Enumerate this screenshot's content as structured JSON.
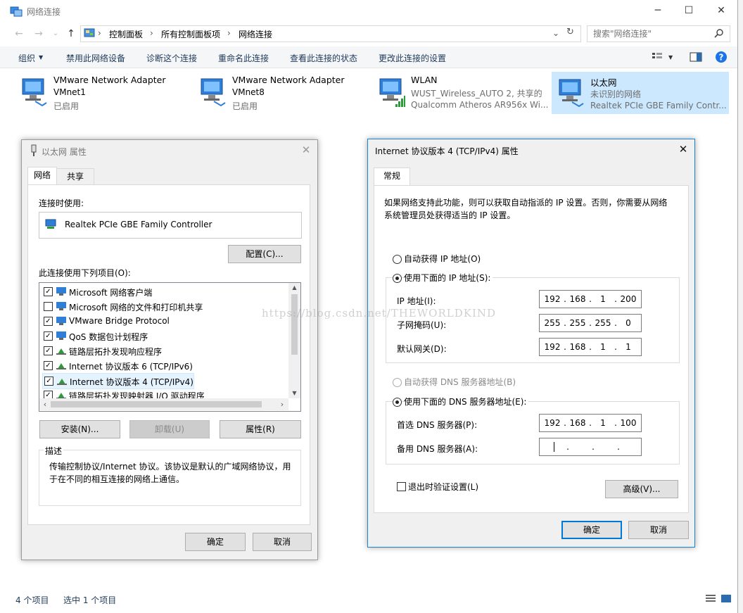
{
  "window": {
    "title": "网络连接",
    "search_placeholder": "搜索\"网络连接\"",
    "breadcrumb": [
      "控制面板",
      "所有控制面板项",
      "网络连接"
    ]
  },
  "commands": [
    "组织",
    "禁用此网络设备",
    "诊断这个连接",
    "重命名此连接",
    "查看此连接的状态",
    "更改此连接的设置"
  ],
  "adapters": [
    {
      "name": "VMware Network Adapter",
      "line2": "VMnet1",
      "line3": "已启用"
    },
    {
      "name": "VMware Network Adapter",
      "line2": "VMnet8",
      "line3": "已启用"
    },
    {
      "name": "WLAN",
      "line2": "WUST_Wireless_AUTO  2, 共享的",
      "line3": "Qualcomm Atheros AR956x Wi..."
    },
    {
      "name": "以太网",
      "line2": "未识别的网络",
      "line3": "Realtek PCIe GBE Family Contr..."
    }
  ],
  "statusbar": {
    "count": "4 个项目",
    "selected": "选中 1 个项目"
  },
  "ethernet_dialog": {
    "title": "以太网 属性",
    "tabs": [
      "网络",
      "共享"
    ],
    "connect_using_label": "连接时使用:",
    "adapter_name": "Realtek PCIe GBE Family Controller",
    "configure_btn": "配置(C)...",
    "items_label": "此连接使用下列项目(O):",
    "items": [
      {
        "label": "Microsoft 网络客户端",
        "checked": true
      },
      {
        "label": "Microsoft 网络的文件和打印机共享",
        "checked": false
      },
      {
        "label": "VMware Bridge Protocol",
        "checked": true
      },
      {
        "label": "QoS 数据包计划程序",
        "checked": true
      },
      {
        "label": "链路层拓扑发现响应程序",
        "checked": true
      },
      {
        "label": "Internet 协议版本 6 (TCP/IPv6)",
        "checked": true
      },
      {
        "label": "Internet 协议版本 4 (TCP/IPv4)",
        "checked": true
      },
      {
        "label": "链路层拓扑发现映射器 I/O 驱动程序",
        "checked": true
      }
    ],
    "install_btn": "安装(N)...",
    "uninstall_btn": "卸载(U)",
    "properties_btn": "属性(R)",
    "description_title": "描述",
    "description": "传输控制协议/Internet 协议。该协议是默认的广域网络协议，用于在不同的相互连接的网络上通信。",
    "ok_btn": "确定",
    "cancel_btn": "取消"
  },
  "ipv4_dialog": {
    "title": "Internet 协议版本 4 (TCP/IPv4) 属性",
    "tab": "常规",
    "intro": "如果网络支持此功能，则可以获取自动指派的 IP 设置。否则，你需要从网络系统管理员处获得适当的 IP 设置。",
    "auto_ip_label": "自动获得 IP 地址(O)",
    "manual_ip_label": "使用下面的 IP 地址(S):",
    "ip_label": "IP 地址(I):",
    "ip": [
      "192",
      "168",
      "1",
      "200"
    ],
    "mask_label": "子网掩码(U):",
    "mask": [
      "255",
      "255",
      "255",
      "0"
    ],
    "gateway_label": "默认网关(D):",
    "gateway": [
      "192",
      "168",
      "1",
      "1"
    ],
    "auto_dns_label": "自动获得 DNS 服务器地址(B)",
    "manual_dns_label": "使用下面的 DNS 服务器地址(E):",
    "pref_dns_label": "首选 DNS 服务器(P):",
    "pref_dns": [
      "192",
      "168",
      "1",
      "100"
    ],
    "alt_dns_label": "备用 DNS 服务器(A):",
    "alt_dns": [
      "",
      "",
      "",
      ""
    ],
    "validate_label": "退出时验证设置(L)",
    "advanced_btn": "高级(V)...",
    "ok_btn": "确定",
    "cancel_btn": "取消"
  },
  "watermark": "https://blog.csdn.net/THEWORLDKIND",
  "colors": {
    "accent": "#0078d7",
    "selection": "#cce8ff",
    "dialog_bg": "#f0f0f0",
    "link": "#1e395b"
  }
}
